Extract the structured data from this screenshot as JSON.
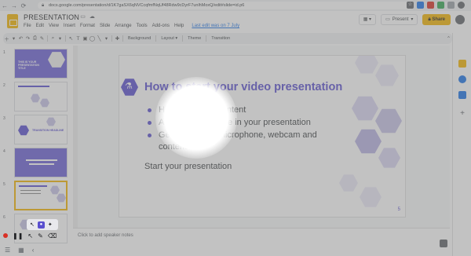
{
  "browser": {
    "url": "docs.google.com/presentation/d/1K7gaSX6qNVCcqfmfNqUf48Rdw9cDyrF7unlhMoxQ/edit#slide=id.p6",
    "back_icon": "arrow-left-icon",
    "forward_icon": "arrow-right-icon",
    "reload_icon": "reload-icon"
  },
  "doc": {
    "title": "PRESENTATION",
    "menu": [
      "File",
      "Edit",
      "View",
      "Insert",
      "Format",
      "Slide",
      "Arrange",
      "Tools",
      "Add-ons",
      "Help"
    ],
    "last_edit": "Last edit was on 7 July",
    "present_label": "Present",
    "share_label": "Share"
  },
  "toolbar": {
    "background_label": "Background",
    "layout_label": "Layout",
    "theme_label": "Theme",
    "transition_label": "Transition"
  },
  "filmstrip": {
    "slides": [
      {
        "num": "1",
        "title": "THIS IS YOUR PRESENTATION TITLE"
      },
      {
        "num": "2",
        "title": ""
      },
      {
        "num": "3",
        "title": "TRANSITION HEADLINE"
      },
      {
        "num": "4",
        "title": ""
      },
      {
        "num": "5",
        "title": ""
      },
      {
        "num": "6",
        "title": ""
      }
    ]
  },
  "slide": {
    "heading": "How to start your video presentation",
    "bullets": [
      "Have a draft of content",
      "Add some example in your presentation",
      "Get ready your microphone, webcam and content"
    ],
    "bullet_line3_part1": "Get ready your microphone, webcam and",
    "bullet_line3_part2": "content",
    "closing": "Start your presentation",
    "page_number": "5"
  },
  "notes": {
    "placeholder": "Click to add speaker notes"
  },
  "colors": {
    "accent": "#5a4fcf",
    "share": "#f4b400",
    "record": "#d93025"
  }
}
